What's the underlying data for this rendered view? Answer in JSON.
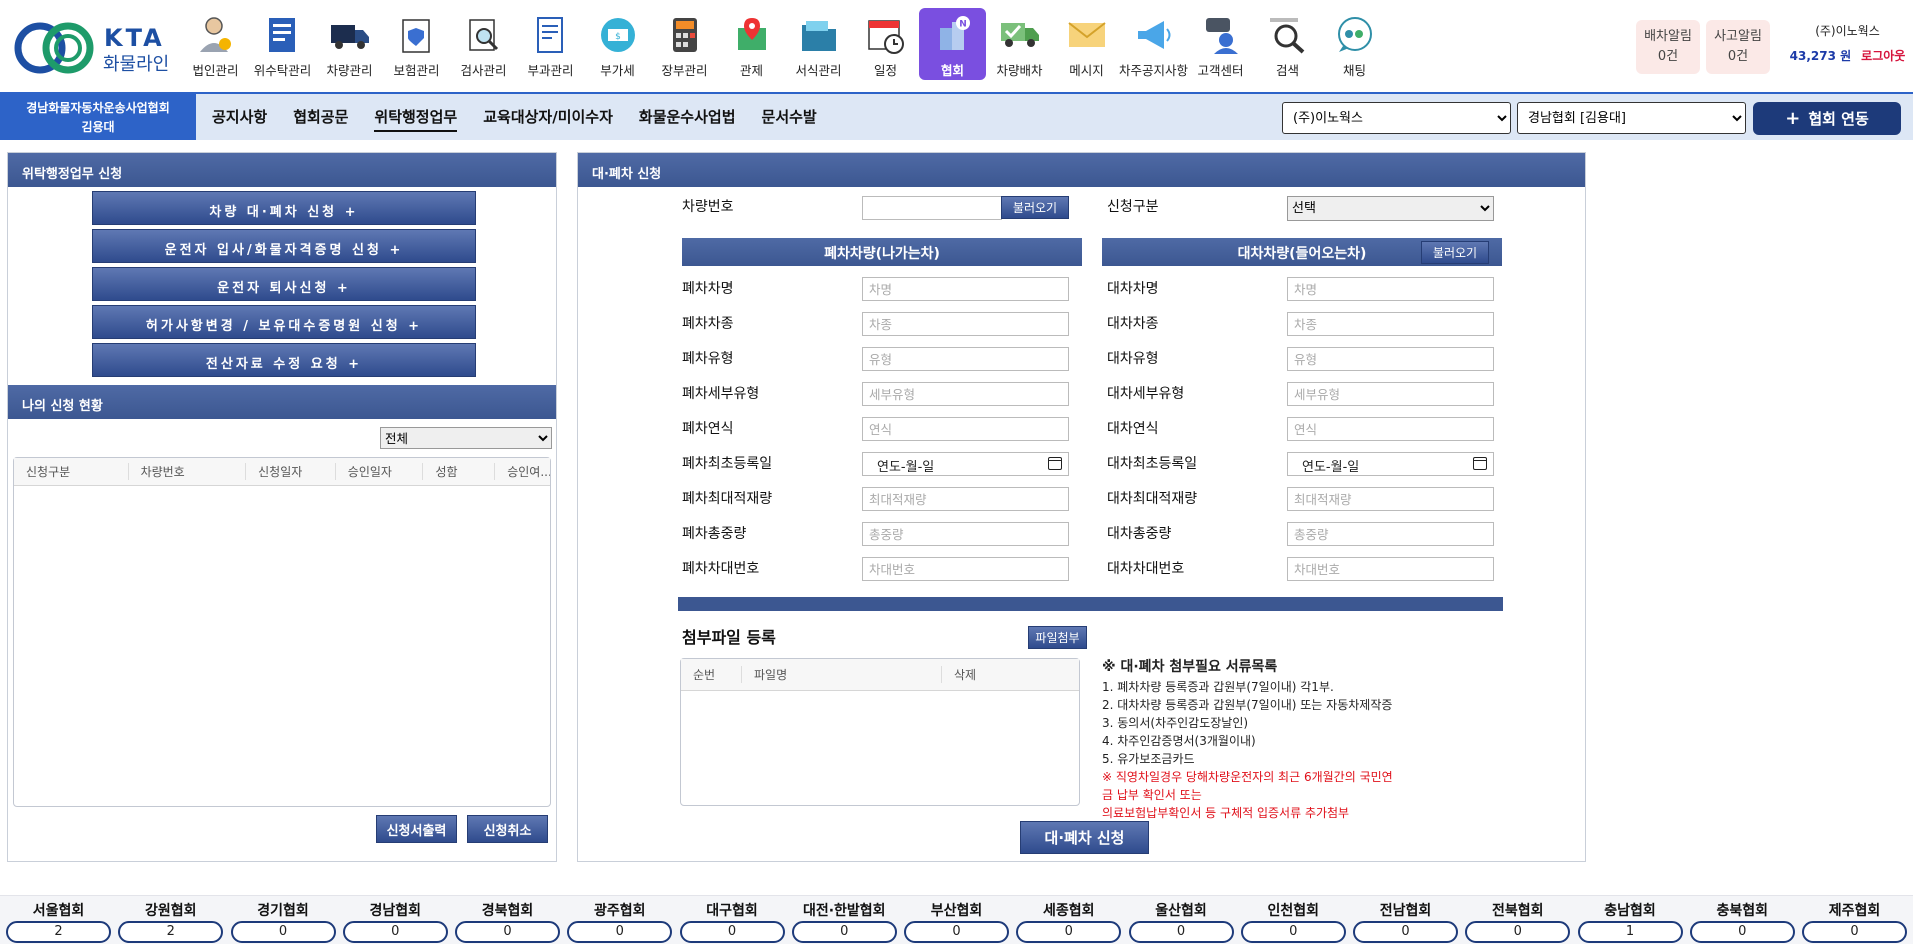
{
  "brand": {
    "kta": "KTA",
    "name": "화물라인"
  },
  "menu": [
    {
      "label": "법인관리",
      "icon": "person-gear-icon"
    },
    {
      "label": "위수탁관리",
      "icon": "document-icon"
    },
    {
      "label": "차량관리",
      "icon": "truck-icon"
    },
    {
      "label": "보험관리",
      "icon": "shield-clipboard-icon"
    },
    {
      "label": "검사관리",
      "icon": "magnifier-clipboard-icon"
    },
    {
      "label": "부과관리",
      "icon": "invoice-icon"
    },
    {
      "label": "부가세",
      "icon": "money-icon"
    },
    {
      "label": "장부관리",
      "icon": "calculator-icon"
    },
    {
      "label": "관제",
      "icon": "map-pin-icon"
    },
    {
      "label": "서식관리",
      "icon": "folder-icon"
    },
    {
      "label": "일정",
      "icon": "calendar-clock-icon"
    },
    {
      "label": "협회",
      "icon": "building-icon",
      "badge": "N"
    },
    {
      "label": "차량배차",
      "icon": "truck-check-icon"
    },
    {
      "label": "메시지",
      "icon": "envelope-icon"
    },
    {
      "label": "차주공지사항",
      "icon": "megaphone-icon"
    },
    {
      "label": "고객센터",
      "icon": "support-icon"
    },
    {
      "label": "검색",
      "icon": "search-icon"
    },
    {
      "label": "채팅",
      "icon": "chat-icon"
    }
  ],
  "alerts": {
    "dispatch": {
      "label": "배차알림",
      "count": "0건"
    },
    "accident": {
      "label": "사고알림",
      "count": "0건"
    }
  },
  "user": {
    "company": "(주)이노웍스",
    "points": "43,273 원",
    "logout": "로그아웃"
  },
  "org": {
    "name": "경남화물자동차운송사업협회",
    "person": "김용대"
  },
  "nav": {
    "tabs": [
      "공지사항",
      "협회공문",
      "위탁행정업무",
      "교육대상자/미이수자",
      "화물운수사업법",
      "문서수발"
    ],
    "company_select": "(주)이노웍스",
    "assoc_select": "경남협회 [김용대]",
    "link_button": "협회 연동",
    "link_icon": "plus-icon"
  },
  "left": {
    "title": "위탁행정업무 신청",
    "buttons": [
      "차량 대·폐차 신청 +",
      "운전자 입사/화물자격증명 신청 +",
      "운전자 퇴사신청 +",
      "허가사항변경 / 보유대수증명원 신청 +",
      "전산자료 수정 요청 +"
    ],
    "status_title": "나의 신청 현황",
    "filter": "전체",
    "columns": [
      "신청구분",
      "차량번호",
      "신청일자",
      "승인일자",
      "성함",
      "승인여..."
    ],
    "print_button": "신청서출력",
    "cancel_button": "신청취소"
  },
  "right": {
    "title": "대·폐차 신청",
    "vehicle_no_label": "차량번호",
    "load_button": "불러오기",
    "apply_type_label": "신청구분",
    "apply_type_value": "선택",
    "out_title": "폐차차량(나가는차)",
    "in_title": "대차차량(들어오는차)",
    "out_fields": [
      {
        "label": "폐차차명",
        "ph": "차명"
      },
      {
        "label": "폐차차종",
        "ph": "차종"
      },
      {
        "label": "폐차유형",
        "ph": "유형"
      },
      {
        "label": "폐차세부유형",
        "ph": "세부유형"
      },
      {
        "label": "폐차연식",
        "ph": "연식"
      },
      {
        "label": "폐차최초등록일",
        "ph": "연도-월-일"
      },
      {
        "label": "폐차최대적재량",
        "ph": "최대적재량"
      },
      {
        "label": "폐차총중량",
        "ph": "총중량"
      },
      {
        "label": "폐차차대번호",
        "ph": "차대번호"
      }
    ],
    "in_fields": [
      {
        "label": "대차차명",
        "ph": "차명"
      },
      {
        "label": "대차차종",
        "ph": "차종"
      },
      {
        "label": "대차유형",
        "ph": "유형"
      },
      {
        "label": "대차세부유형",
        "ph": "세부유형"
      },
      {
        "label": "대차연식",
        "ph": "연식"
      },
      {
        "label": "대차최초등록일",
        "ph": "연도-월-일"
      },
      {
        "label": "대차최대적재량",
        "ph": "최대적재량"
      },
      {
        "label": "대차총중량",
        "ph": "총중량"
      },
      {
        "label": "대차차대번호",
        "ph": "차대번호"
      }
    ],
    "attach_title": "첨부파일 등록",
    "attach_button": "파일첨부",
    "attach_columns": [
      "순번",
      "파일명",
      "삭제"
    ],
    "docs_title": "※ 대·폐차 첨부필요 서류목록",
    "docs": [
      "1. 폐차차량 등록증과 갑원부(7일이내) 각1부.",
      "2. 대차차량 등록증과 갑원부(7일이내) 또는 자동차제작증",
      "3. 동의서(차주인감도장날인)",
      "4. 차주인감증명서(3개월이내)",
      "5. 유가보조금카드"
    ],
    "docs_note": [
      "※ 직영차일경우 당해차량운전자의 최근 6개월간의 국민연금 납부 확인서 또는",
      "의료보험납부확인서 등 구체적 입증서류 추가첨부"
    ],
    "submit_button": "대·폐차 신청"
  },
  "footer": [
    {
      "name": "서울협회",
      "count": "2"
    },
    {
      "name": "강원협회",
      "count": "2"
    },
    {
      "name": "경기협회",
      "count": "0"
    },
    {
      "name": "경남협회",
      "count": "0"
    },
    {
      "name": "경북협회",
      "count": "0"
    },
    {
      "name": "광주협회",
      "count": "0"
    },
    {
      "name": "대구협회",
      "count": "0"
    },
    {
      "name": "대전·한밭협회",
      "count": "0"
    },
    {
      "name": "부산협회",
      "count": "0"
    },
    {
      "name": "세종협회",
      "count": "0"
    },
    {
      "name": "울산협회",
      "count": "0"
    },
    {
      "name": "인천협회",
      "count": "0"
    },
    {
      "name": "전남협회",
      "count": "0"
    },
    {
      "name": "전북협회",
      "count": "0"
    },
    {
      "name": "충남협회",
      "count": "1"
    },
    {
      "name": "충북협회",
      "count": "0"
    },
    {
      "name": "제주협회",
      "count": "0"
    }
  ],
  "colors": {
    "accent": "#2d63c8",
    "panel_head": "#3c5791",
    "active_menu": "#7a4fe0",
    "logout": "#d6133c"
  }
}
